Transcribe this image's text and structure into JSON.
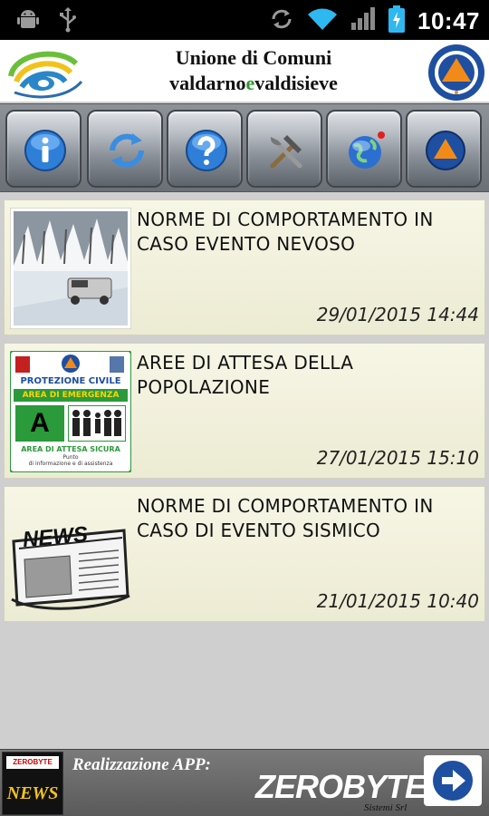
{
  "status_bar": {
    "time": "10:47",
    "icons": [
      "android-debug-icon",
      "usb-icon",
      "sync-icon",
      "wifi-icon",
      "signal-icon",
      "battery-charging-icon"
    ]
  },
  "header": {
    "title_line1": "Unione di Comuni",
    "title_line2_part1": "valdarno",
    "title_line2_part2": "e",
    "title_line2_part3": "valdisieve",
    "left_logo": "union-logo",
    "right_logo": "protezione-civile-emblem"
  },
  "toolbar": {
    "buttons": [
      {
        "icon": "info-icon"
      },
      {
        "icon": "refresh-icon"
      },
      {
        "icon": "help-icon"
      },
      {
        "icon": "tools-icon"
      },
      {
        "icon": "globe-icon"
      },
      {
        "icon": "civil-protection-icon"
      }
    ]
  },
  "news": [
    {
      "title": "NORME DI COMPORTAMENTO IN CASO EVENTO NEVOSO",
      "date": "29/01/2015 14:44",
      "thumb": "snow-photo"
    },
    {
      "title": "AREE DI ATTESA DELLA POPOLAZIONE",
      "date": "27/01/2015 15:10",
      "thumb": "emergency-area-sign"
    },
    {
      "title": "NORME DI COMPORTAMENTO IN CASO DI EVENTO SISMICO",
      "date": "21/01/2015 10:40",
      "thumb": "newspaper-icon"
    }
  ],
  "thumb_text": {
    "sign_header": "PROTEZIONE CIVILE",
    "sign_band": "AREA DI EMERGENZA",
    "sign_letter": "A",
    "sign_bottom": "AREA DI ATTESA SICURA",
    "sign_small1": "Punto",
    "sign_small2": "di informazione e di assistenza",
    "news_word": "NEWS"
  },
  "footer": {
    "label": "Realizzazione APP:",
    "brand": "ZEROBYTE",
    "brand_sub": "Sistemi Srl",
    "badge_top": "ZEROBYTE",
    "badge_word": "NEWS"
  },
  "colors": {
    "accent_blue": "#1e63c6",
    "item_bg": "#f4f3e0",
    "toolbar_bg": "#7b8088",
    "footer_bg": "#666666"
  }
}
